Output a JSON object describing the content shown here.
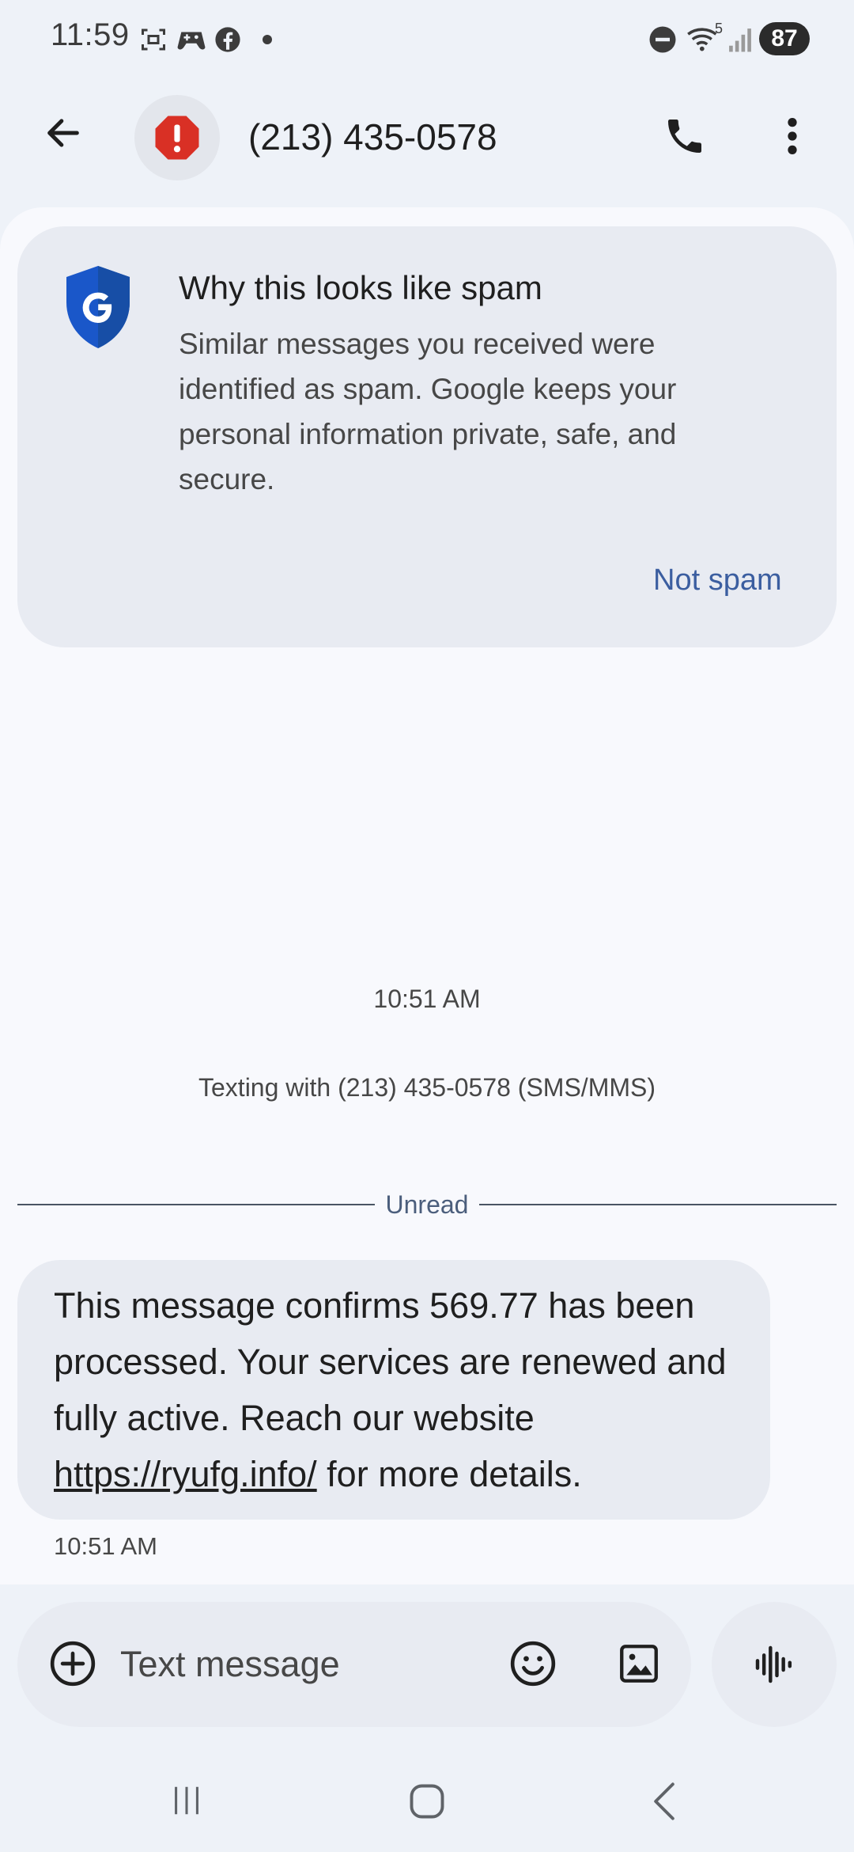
{
  "status_bar": {
    "time": "11:59",
    "battery": "87",
    "icons": [
      "screenshot-icon",
      "game-controller-icon",
      "facebook-icon",
      "dot-icon",
      "do-not-disturb-icon",
      "wifi-icon",
      "signal-icon"
    ],
    "wifi_badge": "5"
  },
  "header": {
    "title": "(213) 435-0578",
    "avatar_icon": "spam-alert-icon",
    "back_icon": "arrow-left-icon",
    "call_icon": "phone-icon",
    "more_icon": "more-vert-icon"
  },
  "spam_card": {
    "title": "Why this looks like spam",
    "body": "Similar messages you received were identified as spam. Google keeps your personal information private, safe, and secure.",
    "action_label": "Not spam",
    "icon": "google-shield-icon"
  },
  "conversation": {
    "top_timestamp": "10:51 AM",
    "texting_with": "Texting with (213) 435-0578 (SMS/MMS)",
    "unread_label": "Unread",
    "message": {
      "text_before": "This message confirms 569.77 has been processed. Your services are renewed and fully active. Reach our website ",
      "link": "https://ryufg.info/",
      "text_after": " for more details.",
      "time": "10:51 AM"
    }
  },
  "compose": {
    "placeholder": "Text message",
    "add_icon": "add-circle-icon",
    "emoji_icon": "emoji-icon",
    "image_icon": "image-icon",
    "voice_icon": "voice-waveform-icon"
  },
  "colors": {
    "background": "#eef2f8",
    "surface": "#f8f9fd",
    "card": "#e8ebf2",
    "accent": "#3b5ea0",
    "alert_red": "#d93025",
    "shield_blue": "#1a57c9"
  }
}
